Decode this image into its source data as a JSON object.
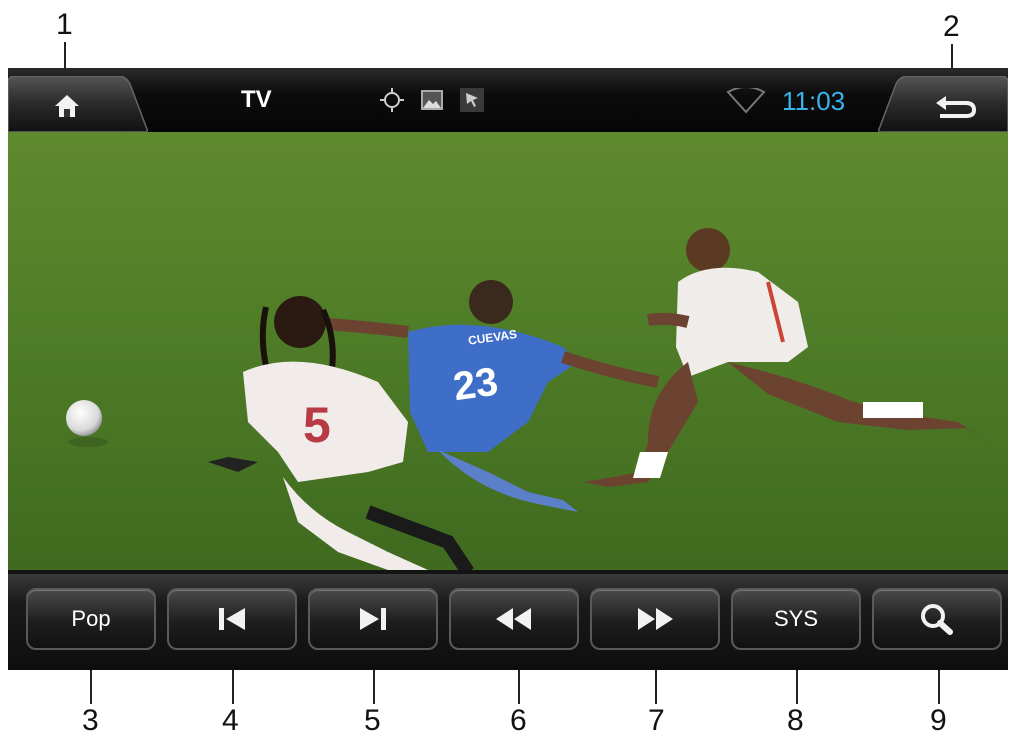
{
  "callouts": {
    "c1": "1",
    "c2": "2",
    "c3": "3",
    "c4": "4",
    "c5": "5",
    "c6": "6",
    "c7": "7",
    "c8": "8",
    "c9": "9"
  },
  "statusbar": {
    "title": "TV",
    "clock": "11:03",
    "icons": [
      "gps-crosshair-icon",
      "picture-icon",
      "cursor-icon",
      "wifi-icon"
    ],
    "home_icon": "home-icon",
    "back_icon": "back-arrow-icon"
  },
  "video": {
    "jersey_number_blue": "23",
    "jersey_name_blue": "CUEVAS",
    "jersey_number_white": "5"
  },
  "controls": {
    "pop_label": "Pop",
    "sys_label": "SYS",
    "icons": [
      "previous-icon",
      "next-icon",
      "rewind-icon",
      "fast-forward-icon",
      "search-icon"
    ]
  },
  "colors": {
    "clock": "#3ab3ea",
    "pitch": "#4f7a2a"
  }
}
